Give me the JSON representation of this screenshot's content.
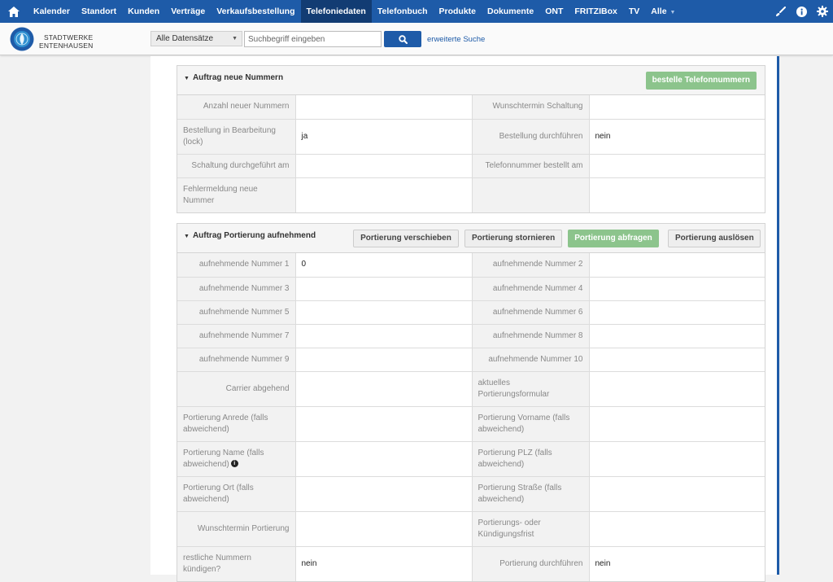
{
  "nav": {
    "items": [
      {
        "label": "Kalender",
        "active": false
      },
      {
        "label": "Standort",
        "active": false
      },
      {
        "label": "Kunden",
        "active": false
      },
      {
        "label": "Verträge",
        "active": false
      },
      {
        "label": "Verkaufsbestellung",
        "active": false
      },
      {
        "label": "Telefoniedaten",
        "active": true
      },
      {
        "label": "Telefonbuch",
        "active": false
      },
      {
        "label": "Produkte",
        "active": false
      },
      {
        "label": "Dokumente",
        "active": false
      },
      {
        "label": "ONT",
        "active": false
      },
      {
        "label": "FRITZIBox",
        "active": false
      },
      {
        "label": "TV",
        "active": false
      }
    ],
    "more_label": "Alle",
    "colors": {
      "bar": "#1e5ba8",
      "active": "#123c73"
    }
  },
  "header": {
    "brand_line1": "Stadtwerke",
    "brand_line2": "Entenhausen",
    "dataset_select": "Alle Datensätze",
    "search_placeholder": "Suchbegriff eingeben",
    "advanced_search": "erweiterte Suche"
  },
  "order_new": {
    "title": "Auftrag neue Nummern",
    "button": "bestelle Telefonnummern",
    "rows": [
      {
        "l1": "Anzahl neuer Nummern",
        "v1": "",
        "l2": "Wunschtermin Schaltung",
        "v2": ""
      },
      {
        "l1": "Bestellung in Bearbeitung (lock)",
        "v1": "ja",
        "l2": "Bestellung durchführen",
        "v2": "nein"
      },
      {
        "l1": "Schaltung durchgeführt am",
        "v1": "",
        "l2": "Telefonnummer bestellt am",
        "v2": ""
      },
      {
        "l1": "Fehlermeldung neue Nummer",
        "v1": "",
        "l2": "",
        "v2": ""
      }
    ]
  },
  "porting": {
    "title": "Auftrag Portierung aufnehmend",
    "buttons": {
      "move": "Portierung verschieben",
      "cancel": "Portierung stornieren",
      "query": "Portierung abfragen",
      "trigger": "Portierung auslösen"
    },
    "rows": [
      {
        "l1": "aufnehmende Nummer 1",
        "v1": "0",
        "l2": "aufnehmende Nummer 2",
        "v2": ""
      },
      {
        "l1": "aufnehmende Nummer 3",
        "v1": "",
        "l2": "aufnehmende Nummer 4",
        "v2": ""
      },
      {
        "l1": "aufnehmende Nummer 5",
        "v1": "",
        "l2": "aufnehmende Nummer 6",
        "v2": ""
      },
      {
        "l1": "aufnehmende Nummer 7",
        "v1": "",
        "l2": "aufnehmende Nummer 8",
        "v2": ""
      },
      {
        "l1": "aufnehmende Nummer 9",
        "v1": "",
        "l2": "aufnehmende Nummer 10",
        "v2": ""
      },
      {
        "l1": "Carrier abgehend",
        "v1": "",
        "l2": "aktuelles Portierungsformular",
        "v2": ""
      },
      {
        "l1": "Portierung Anrede (falls abweichend)",
        "v1": "",
        "l2": "Portierung Vorname (falls abweichend)",
        "v2": ""
      },
      {
        "l1": "Portierung Name (falls abweichend)",
        "v1": "",
        "l2": "Portierung PLZ (falls abweichend)",
        "v2": ""
      },
      {
        "l1": "Portierung Ort (falls abweichend)",
        "v1": "",
        "l2": "Portierung Straße (falls abweichend)",
        "v2": ""
      },
      {
        "l1": "Wunschtermin Portierung",
        "v1": "",
        "l2": "Portierungs- oder Kündigungsfrist",
        "v2": ""
      },
      {
        "l1": "restliche Nummern kündigen?",
        "v1": "nein",
        "l2": "Portierung durchführen",
        "v2": "nein"
      }
    ]
  }
}
